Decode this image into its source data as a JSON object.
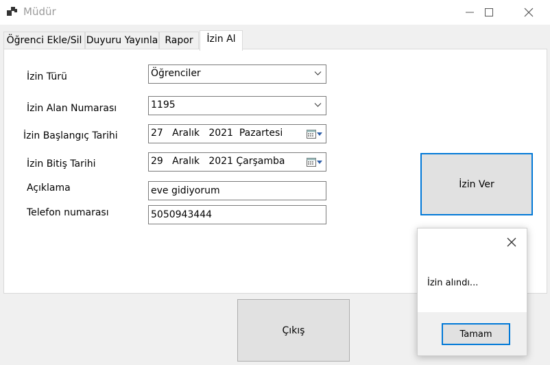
{
  "window": {
    "title": "Müdür"
  },
  "tabs": [
    {
      "label": "Öğrenci Ekle/Sil"
    },
    {
      "label": "Duyuru Yayınla"
    },
    {
      "label": "Rapor"
    },
    {
      "label": "İzin Al"
    }
  ],
  "form": {
    "leave_type": {
      "label": "İzin Türü",
      "value": "Öğrenciler"
    },
    "student_number": {
      "label": "İzin Alan Numarası",
      "value": "1195"
    },
    "start_date": {
      "label": "İzin Başlangıç Tarihi",
      "value": "27   Aralık   2021  Pazartesi"
    },
    "end_date": {
      "label": "İzin Bitiş Tarihi",
      "value": "29   Aralık   2021 Çarşamba"
    },
    "description": {
      "label": "Açıklama",
      "value": "eve gidiyorum"
    },
    "phone": {
      "label": "Telefon numarası",
      "value": "5050943444"
    }
  },
  "buttons": {
    "grant": "İzin Ver",
    "exit": "Çıkış"
  },
  "dialog": {
    "message": "İzin alındı...",
    "ok": "Tamam"
  },
  "colors": {
    "accent": "#0078d7",
    "button_face": "#e1e1e1",
    "window_bg": "#f0f0f0"
  }
}
